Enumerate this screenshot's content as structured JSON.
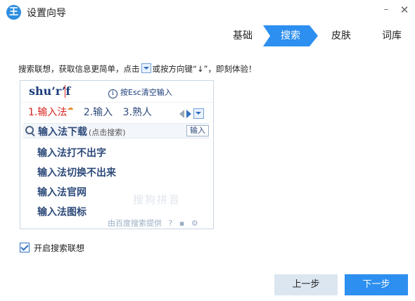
{
  "window": {
    "logo_text": "王",
    "title": "设置向导",
    "minimize": "–",
    "close": "✕"
  },
  "tabs": [
    {
      "label": "基础",
      "active": false
    },
    {
      "label": "搜索",
      "active": true
    },
    {
      "label": "皮肤",
      "active": false
    },
    {
      "label": "词库",
      "active": false
    }
  ],
  "colors": {
    "accent": "#2d8ff0",
    "tab_active_bg": "#2d8ff0",
    "selected_candidate": "#d9231d",
    "secondary_button_bg": "#dce6f1"
  },
  "hint": {
    "part1": "搜索联想，获取信息更简单，点击",
    "part2": "或按方向键“↓”，即刻体验！"
  },
  "ime": {
    "pinyin": "shu’r’f",
    "esc_hint": "按Esc清空输入",
    "info_icon": "i",
    "candidates": [
      {
        "label": "1.输入法",
        "selected": true
      },
      {
        "label": "2.输入",
        "selected": false
      },
      {
        "label": "3.熟人",
        "selected": false
      }
    ],
    "cloud_icon": "☁",
    "search": {
      "query": "输入法下载",
      "hint": "(点击搜索)",
      "button": "输入"
    },
    "suggestions": [
      "输入法打不出字",
      "输入法切换不出来",
      "输入法官网",
      "输入法图标"
    ],
    "watermark": "搜狗拼音",
    "provider": "由百度搜索提供",
    "help_icon": "?",
    "chat_icon": "▪",
    "gear_icon": "⚙"
  },
  "options": {
    "enable_search_suggest": {
      "label": "开启搜索联想",
      "checked": true
    }
  },
  "buttons": {
    "prev": "上一步",
    "next": "下一步"
  }
}
